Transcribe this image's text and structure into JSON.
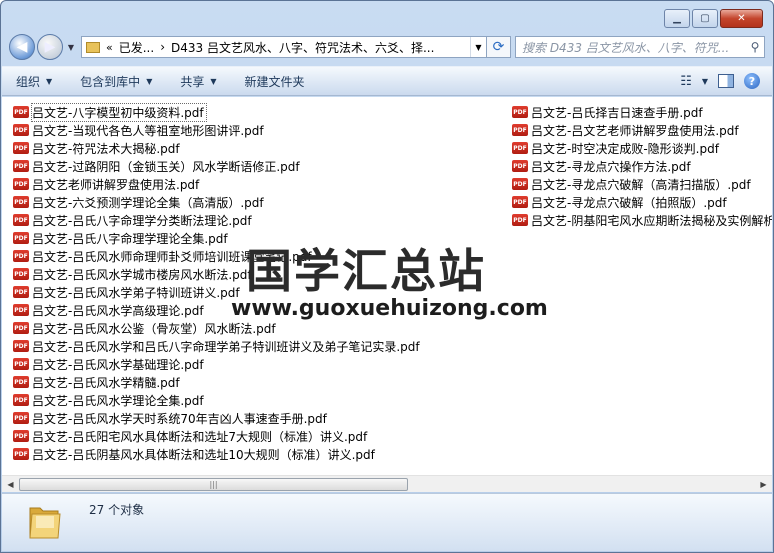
{
  "window": {
    "controls": {
      "minimize": "▁",
      "maximize": "▢",
      "close": "✕"
    }
  },
  "nav": {
    "back_icon": "back-arrow",
    "address": {
      "chevron": "«",
      "parts": "已发...",
      "separator": "›",
      "current": "D433 吕文艺风水、八字、符咒法术、六爻、择..."
    },
    "search_placeholder": "搜索 D433 吕文艺风水、八字、符咒..."
  },
  "toolbar": {
    "organize": "组织",
    "include_library": "包含到库中",
    "share": "共享",
    "new_folder": "新建文件夹"
  },
  "files": {
    "icon_label": "PDF",
    "column1": [
      "吕文艺-八字模型初中级资料.pdf",
      "吕文艺-当现代各色人等祖室地形图讲评.pdf",
      "吕文艺-符咒法术大揭秘.pdf",
      "吕文艺-过路阴阳（金锁玉关）风水学断语修正.pdf",
      "吕文艺老师讲解罗盘使用法.pdf",
      "吕文艺-六爻预测学理论全集（高清版）.pdf",
      "吕文艺-吕氏八字命理学分类断法理论.pdf",
      "吕文艺-吕氏八字命理学理论全集.pdf",
      "吕文艺-吕氏风水师命理师卦爻师培训班课堂笔记.pdf",
      "吕文艺-吕氏风水学城市楼房风水断法.pdf",
      "吕文艺-吕氏风水学弟子特训班讲义.pdf",
      "吕文艺-吕氏风水学高级理论.pdf",
      "吕文艺-吕氏风水公鉴（骨灰堂）风水断法.pdf",
      "吕文艺-吕氏风水学和吕氏八字命理学弟子特训班讲义及弟子笔记实录.pdf",
      "吕文艺-吕氏风水学基础理论.pdf",
      "吕文艺-吕氏风水学精髓.pdf",
      "吕文艺-吕氏风水学理论全集.pdf",
      "吕文艺-吕氏风水学天时系统70年吉凶人事速查手册.pdf",
      "吕文艺-吕氏阳宅风水具体断法和选址7大规则（标准）讲义.pdf",
      "吕文艺-吕氏阴基风水具体断法和选址10大规则（标准）讲义.pdf"
    ],
    "column2": [
      "吕文艺-吕氏择吉日速查手册.pdf",
      "吕文艺-吕文艺老师讲解罗盘使用法.pdf",
      "吕文艺-时空决定成败-隐形谈判.pdf",
      "吕文艺-寻龙点穴操作方法.pdf",
      "吕文艺-寻龙点穴破解（高清扫描版）.pdf",
      "吕文艺-寻龙点穴破解（拍照版）.pdf",
      "吕文艺-阴基阳宅风水应期断法揭秘及实例解析"
    ]
  },
  "watermark": {
    "chinese": "国学汇总站",
    "url": "www.guoxuehuizong.com"
  },
  "status": {
    "item_count": "27 个对象"
  }
}
